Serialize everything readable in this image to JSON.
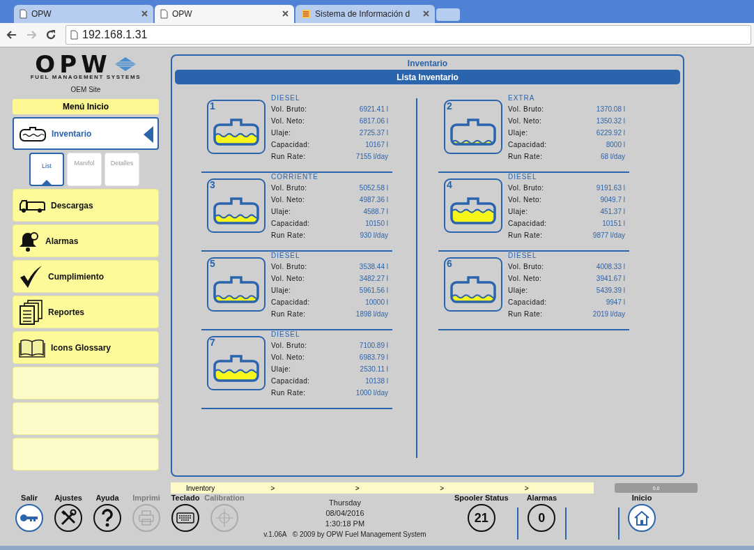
{
  "browser": {
    "tabs": [
      {
        "title": "OPW",
        "kind": "page",
        "selected": false
      },
      {
        "title": "OPW",
        "kind": "page",
        "selected": true
      },
      {
        "title": "Sistema de Información d",
        "kind": "app",
        "selected": false
      }
    ],
    "address": "192.168.1.31"
  },
  "logo": {
    "mark": "OPW",
    "tagline": "FUEL MANAGEMENT SYSTEMS",
    "site": "OEM Site"
  },
  "sidebar": {
    "header": "Menú Inicio",
    "items": [
      {
        "label": "Inventario",
        "kind": "tank",
        "selected": true
      },
      {
        "label": "Descargas",
        "kind": "truck",
        "selected": false
      },
      {
        "label": "Alarmas",
        "kind": "bell",
        "selected": false
      },
      {
        "label": "Cumplimiento",
        "kind": "check",
        "selected": false
      },
      {
        "label": "Reportes",
        "kind": "pages",
        "selected": false
      },
      {
        "label": "Icons Glossary",
        "kind": "book",
        "selected": false
      },
      {
        "kind": "empty"
      },
      {
        "kind": "empty"
      },
      {
        "kind": "empty"
      }
    ],
    "subtabs": [
      {
        "label": "List",
        "selected": true
      },
      {
        "label": "Manifol",
        "selected": false
      },
      {
        "label": "Detalles",
        "selected": false
      }
    ]
  },
  "panel": {
    "title": "Inventario",
    "subtitle": "Lista Inventario",
    "tanks": [
      {
        "number": "1",
        "product": "DIESEL",
        "fields": [
          {
            "label": "Vol. Bruto:",
            "value": "6921.41 l"
          },
          {
            "label": "Vol. Neto:",
            "value": "6817.06 l"
          },
          {
            "label": "Ulaje:",
            "value": "2725.37 l"
          },
          {
            "label": "Capacidad:",
            "value": "10167 l"
          },
          {
            "label": "Run Rate:",
            "value": "7155 l/day"
          }
        ]
      },
      {
        "number": "2",
        "product": "EXTRA",
        "fields": [
          {
            "label": "Vol. Bruto:",
            "value": "1370.08 l"
          },
          {
            "label": "Vol. Neto:",
            "value": "1350.32 l"
          },
          {
            "label": "Ulaje:",
            "value": "6229.92 l"
          },
          {
            "label": "Capacidad:",
            "value": "8000 l"
          },
          {
            "label": "Run Rate:",
            "value": "68 l/day"
          }
        ]
      },
      {
        "number": "3",
        "product": "CORRIENTE",
        "fields": [
          {
            "label": "Vol. Bruto:",
            "value": "5052.58 l"
          },
          {
            "label": "Vol. Neto:",
            "value": "4987.36 l"
          },
          {
            "label": "Ulaje:",
            "value": "4588.7 l"
          },
          {
            "label": "Capacidad:",
            "value": "10150 l"
          },
          {
            "label": "Run Rate:",
            "value": "930 l/day"
          }
        ]
      },
      {
        "number": "4",
        "product": "DIESEL",
        "fields": [
          {
            "label": "Vol. Bruto:",
            "value": "9191.63 l"
          },
          {
            "label": "Vol. Neto:",
            "value": "9049.7 l"
          },
          {
            "label": "Ulaje:",
            "value": "451.37 l"
          },
          {
            "label": "Capacidad:",
            "value": "10151 l"
          },
          {
            "label": "Run Rate:",
            "value": "9877 l/day"
          }
        ]
      },
      {
        "number": "5",
        "product": "DIESEL",
        "fields": [
          {
            "label": "Vol. Bruto:",
            "value": "3538.44 l"
          },
          {
            "label": "Vol. Neto:",
            "value": "3482.27 l"
          },
          {
            "label": "Ulaje:",
            "value": "5961.56 l"
          },
          {
            "label": "Capacidad:",
            "value": "10000 l"
          },
          {
            "label": "Run Rate:",
            "value": "1898 l/day"
          }
        ]
      },
      {
        "number": "6",
        "product": "DIESEL",
        "fields": [
          {
            "label": "Vol. Bruto:",
            "value": "4008.33 l"
          },
          {
            "label": "Vol. Neto:",
            "value": "3941.67 l"
          },
          {
            "label": "Ulaje:",
            "value": "5439.39 l"
          },
          {
            "label": "Capacidad:",
            "value": "9947 l"
          },
          {
            "label": "Run Rate:",
            "value": "2019 l/day"
          }
        ]
      },
      {
        "number": "7",
        "product": "DIESEL",
        "fields": [
          {
            "label": "Vol. Bruto:",
            "value": "7100.89 l"
          },
          {
            "label": "Vol. Neto:",
            "value": "6983.79 l"
          },
          {
            "label": "Ulaje:",
            "value": "2530.11 l"
          },
          {
            "label": "Capacidad:",
            "value": "10138 l"
          },
          {
            "label": "Run Rate:",
            "value": "1000 l/day"
          }
        ]
      }
    ]
  },
  "breadcrumb": [
    "Inventory",
    ">",
    ">",
    ">",
    ">"
  ],
  "progress": {
    "text": "0.0"
  },
  "toolbar": [
    {
      "label": "Salir",
      "kind": "key",
      "disabled": false,
      "highlighted": true
    },
    {
      "label": "Ajustes",
      "kind": "tools",
      "disabled": false,
      "highlighted": false
    },
    {
      "label": "Ayuda",
      "kind": "help",
      "disabled": false,
      "highlighted": false
    },
    {
      "label": "Imprimi",
      "kind": "printer",
      "disabled": true,
      "highlighted": false
    },
    {
      "label": "Teclado",
      "kind": "keyboard",
      "disabled": false,
      "highlighted": false
    },
    {
      "label": "Calibration",
      "kind": "target",
      "disabled": true,
      "highlighted": false
    }
  ],
  "clock": {
    "day": "Thursday",
    "date": "08/04/2016",
    "time": "1:30:18 PM"
  },
  "footer": {
    "version": "v.1.06A",
    "copyright": "© 2009 by OPW Fuel Management System"
  },
  "spooler": {
    "label": "Spooler Status",
    "value": "21"
  },
  "alarms": {
    "label": "Alarmas",
    "value": "0"
  },
  "home": {
    "label": "Inicio"
  }
}
